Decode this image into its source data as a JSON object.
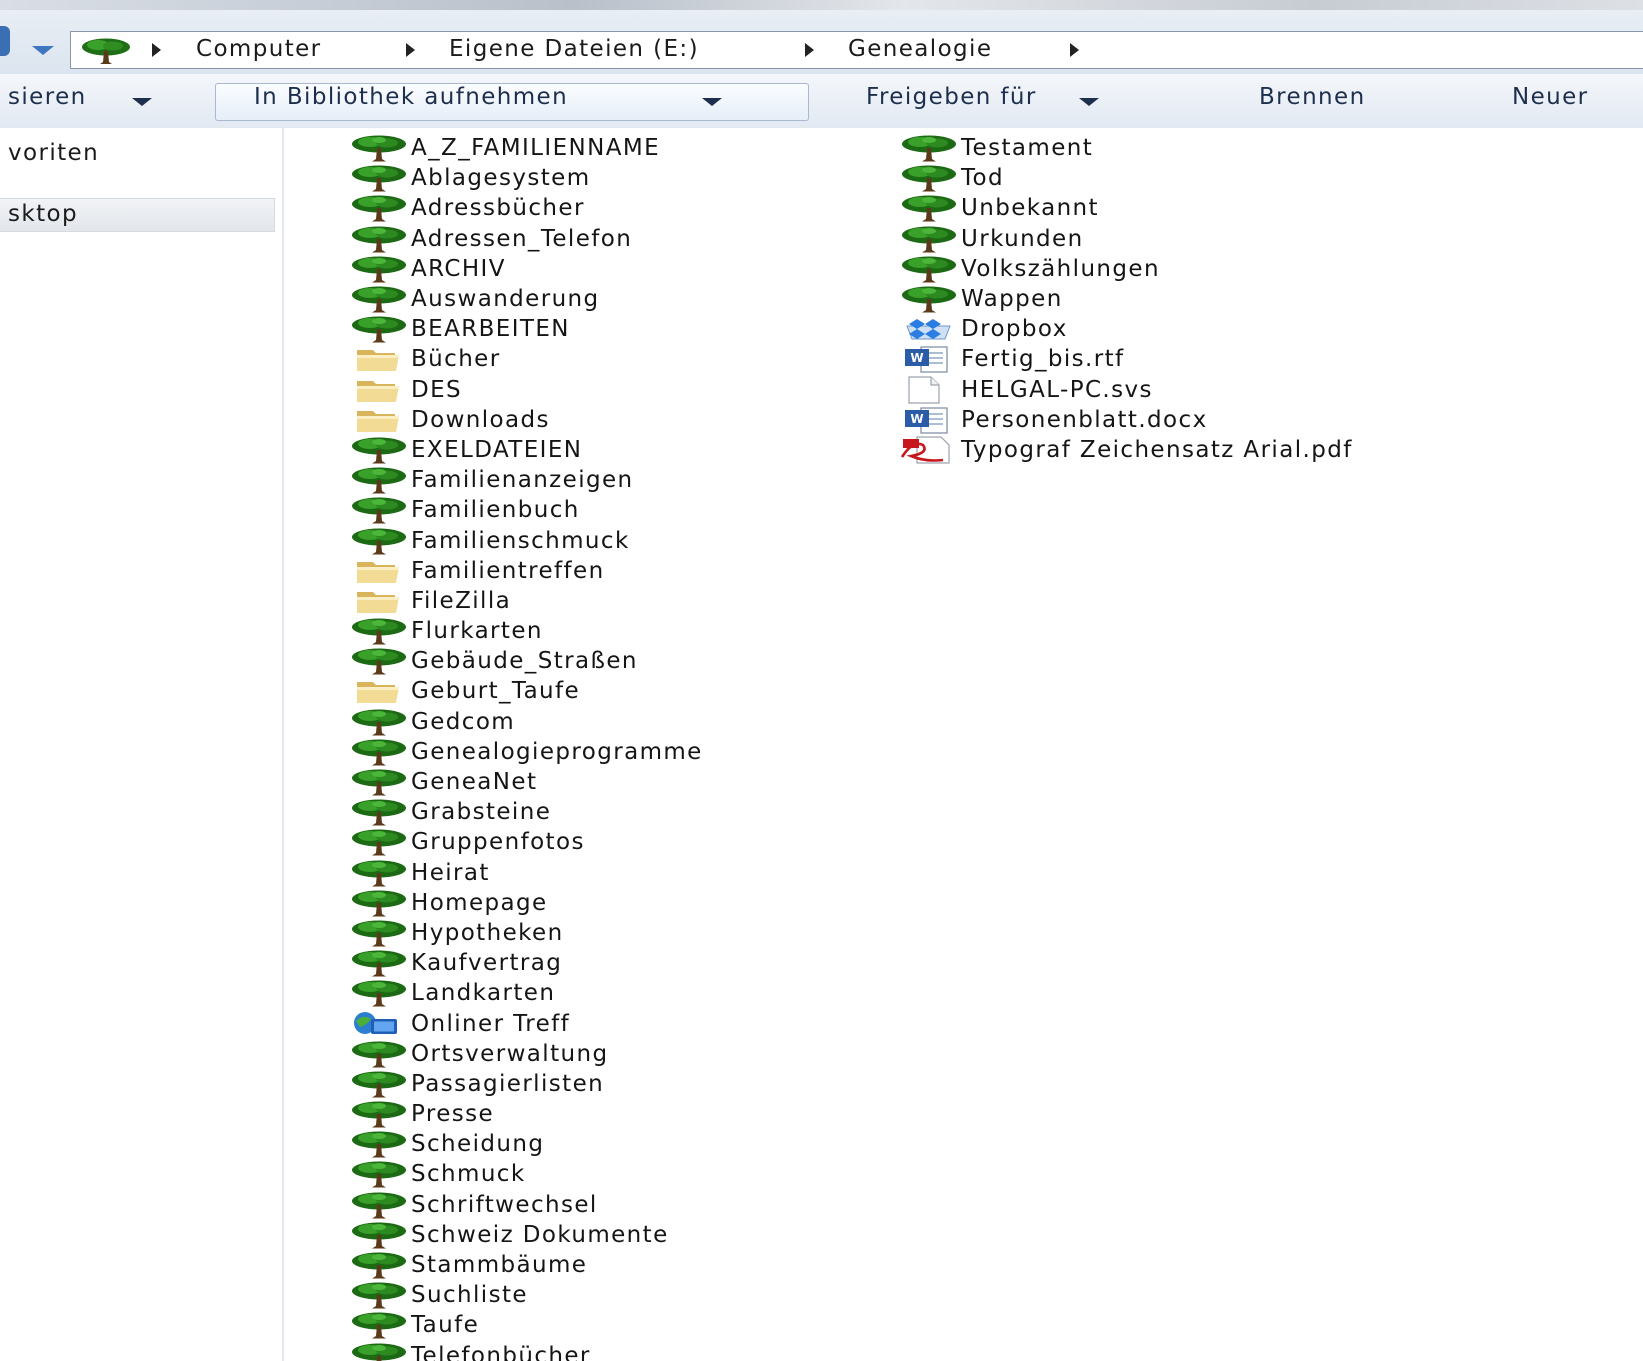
{
  "address_bar": {
    "breadcrumbs": [
      "Computer",
      "Eigene Dateien (E:)",
      "Genealogie"
    ]
  },
  "toolbar": {
    "organize_label": "sieren",
    "library_label": "In Bibliothek aufnehmen",
    "share_label": "Freigeben für",
    "burn_label": "Brennen",
    "new_folder_label": "Neuer"
  },
  "nav_pane": {
    "favorites_label": "voriten",
    "desktop_label": "sktop"
  },
  "files_left": [
    {
      "name": "A_Z_FAMILIENNAME",
      "icon": "tree-icon"
    },
    {
      "name": "Ablagesystem",
      "icon": "tree-icon"
    },
    {
      "name": "Adressbücher",
      "icon": "tree-icon"
    },
    {
      "name": "Adressen_Telefon",
      "icon": "tree-icon"
    },
    {
      "name": "ARCHIV",
      "icon": "tree-icon"
    },
    {
      "name": "Auswanderung",
      "icon": "tree-icon"
    },
    {
      "name": "BEARBEITEN",
      "icon": "tree-icon"
    },
    {
      "name": "Bücher",
      "icon": "folder-icon"
    },
    {
      "name": "DES",
      "icon": "folder-icon"
    },
    {
      "name": "Downloads",
      "icon": "folder-icon"
    },
    {
      "name": "EXELDATEIEN",
      "icon": "tree-icon"
    },
    {
      "name": "Familienanzeigen",
      "icon": "tree-icon"
    },
    {
      "name": "Familienbuch",
      "icon": "tree-icon"
    },
    {
      "name": "Familienschmuck",
      "icon": "tree-icon"
    },
    {
      "name": "Familientreffen",
      "icon": "folder-icon"
    },
    {
      "name": "FileZilla",
      "icon": "folder-icon"
    },
    {
      "name": "Flurkarten",
      "icon": "tree-icon"
    },
    {
      "name": "Gebäude_Straßen",
      "icon": "tree-icon"
    },
    {
      "name": "Geburt_Taufe",
      "icon": "folder-icon"
    },
    {
      "name": "Gedcom",
      "icon": "tree-icon"
    },
    {
      "name": "Genealogieprogramme",
      "icon": "tree-icon"
    },
    {
      "name": "GeneaNet",
      "icon": "tree-icon"
    },
    {
      "name": "Grabsteine",
      "icon": "tree-icon"
    },
    {
      "name": "Gruppenfotos",
      "icon": "tree-icon"
    },
    {
      "name": "Heirat",
      "icon": "tree-icon"
    },
    {
      "name": "Homepage",
      "icon": "tree-icon"
    },
    {
      "name": "Hypotheken",
      "icon": "tree-icon"
    },
    {
      "name": "Kaufvertrag",
      "icon": "tree-icon"
    },
    {
      "name": "Landkarten",
      "icon": "tree-icon"
    },
    {
      "name": "Onliner Treff",
      "icon": "network-icon"
    },
    {
      "name": "Ortsverwaltung",
      "icon": "tree-icon"
    },
    {
      "name": "Passagierlisten",
      "icon": "tree-icon"
    },
    {
      "name": "Presse",
      "icon": "tree-icon"
    },
    {
      "name": "Scheidung",
      "icon": "tree-icon"
    },
    {
      "name": "Schmuck",
      "icon": "tree-icon"
    },
    {
      "name": "Schriftwechsel",
      "icon": "tree-icon"
    },
    {
      "name": "Schweiz Dokumente",
      "icon": "tree-icon"
    },
    {
      "name": "Stammbäume",
      "icon": "tree-icon"
    },
    {
      "name": "Suchliste",
      "icon": "tree-icon"
    },
    {
      "name": "Taufe",
      "icon": "tree-icon"
    },
    {
      "name": "Telefonbücher",
      "icon": "tree-icon"
    }
  ],
  "files_right": [
    {
      "name": "Testament",
      "icon": "tree-icon"
    },
    {
      "name": "Tod",
      "icon": "tree-icon"
    },
    {
      "name": "Unbekannt",
      "icon": "tree-icon"
    },
    {
      "name": "Urkunden",
      "icon": "tree-icon"
    },
    {
      "name": "Volkszählungen",
      "icon": "tree-icon"
    },
    {
      "name": "Wappen",
      "icon": "tree-icon"
    },
    {
      "name": "Dropbox",
      "icon": "dropbox-icon"
    },
    {
      "name": "Fertig_bis.rtf",
      "icon": "word-doc-icon"
    },
    {
      "name": "HELGAL-PC.svs",
      "icon": "blank-file-icon"
    },
    {
      "name": "Personenblatt.docx",
      "icon": "word-doc-icon"
    },
    {
      "name": "Typograf Zeichensatz Arial.pdf",
      "icon": "pdf-icon"
    }
  ]
}
